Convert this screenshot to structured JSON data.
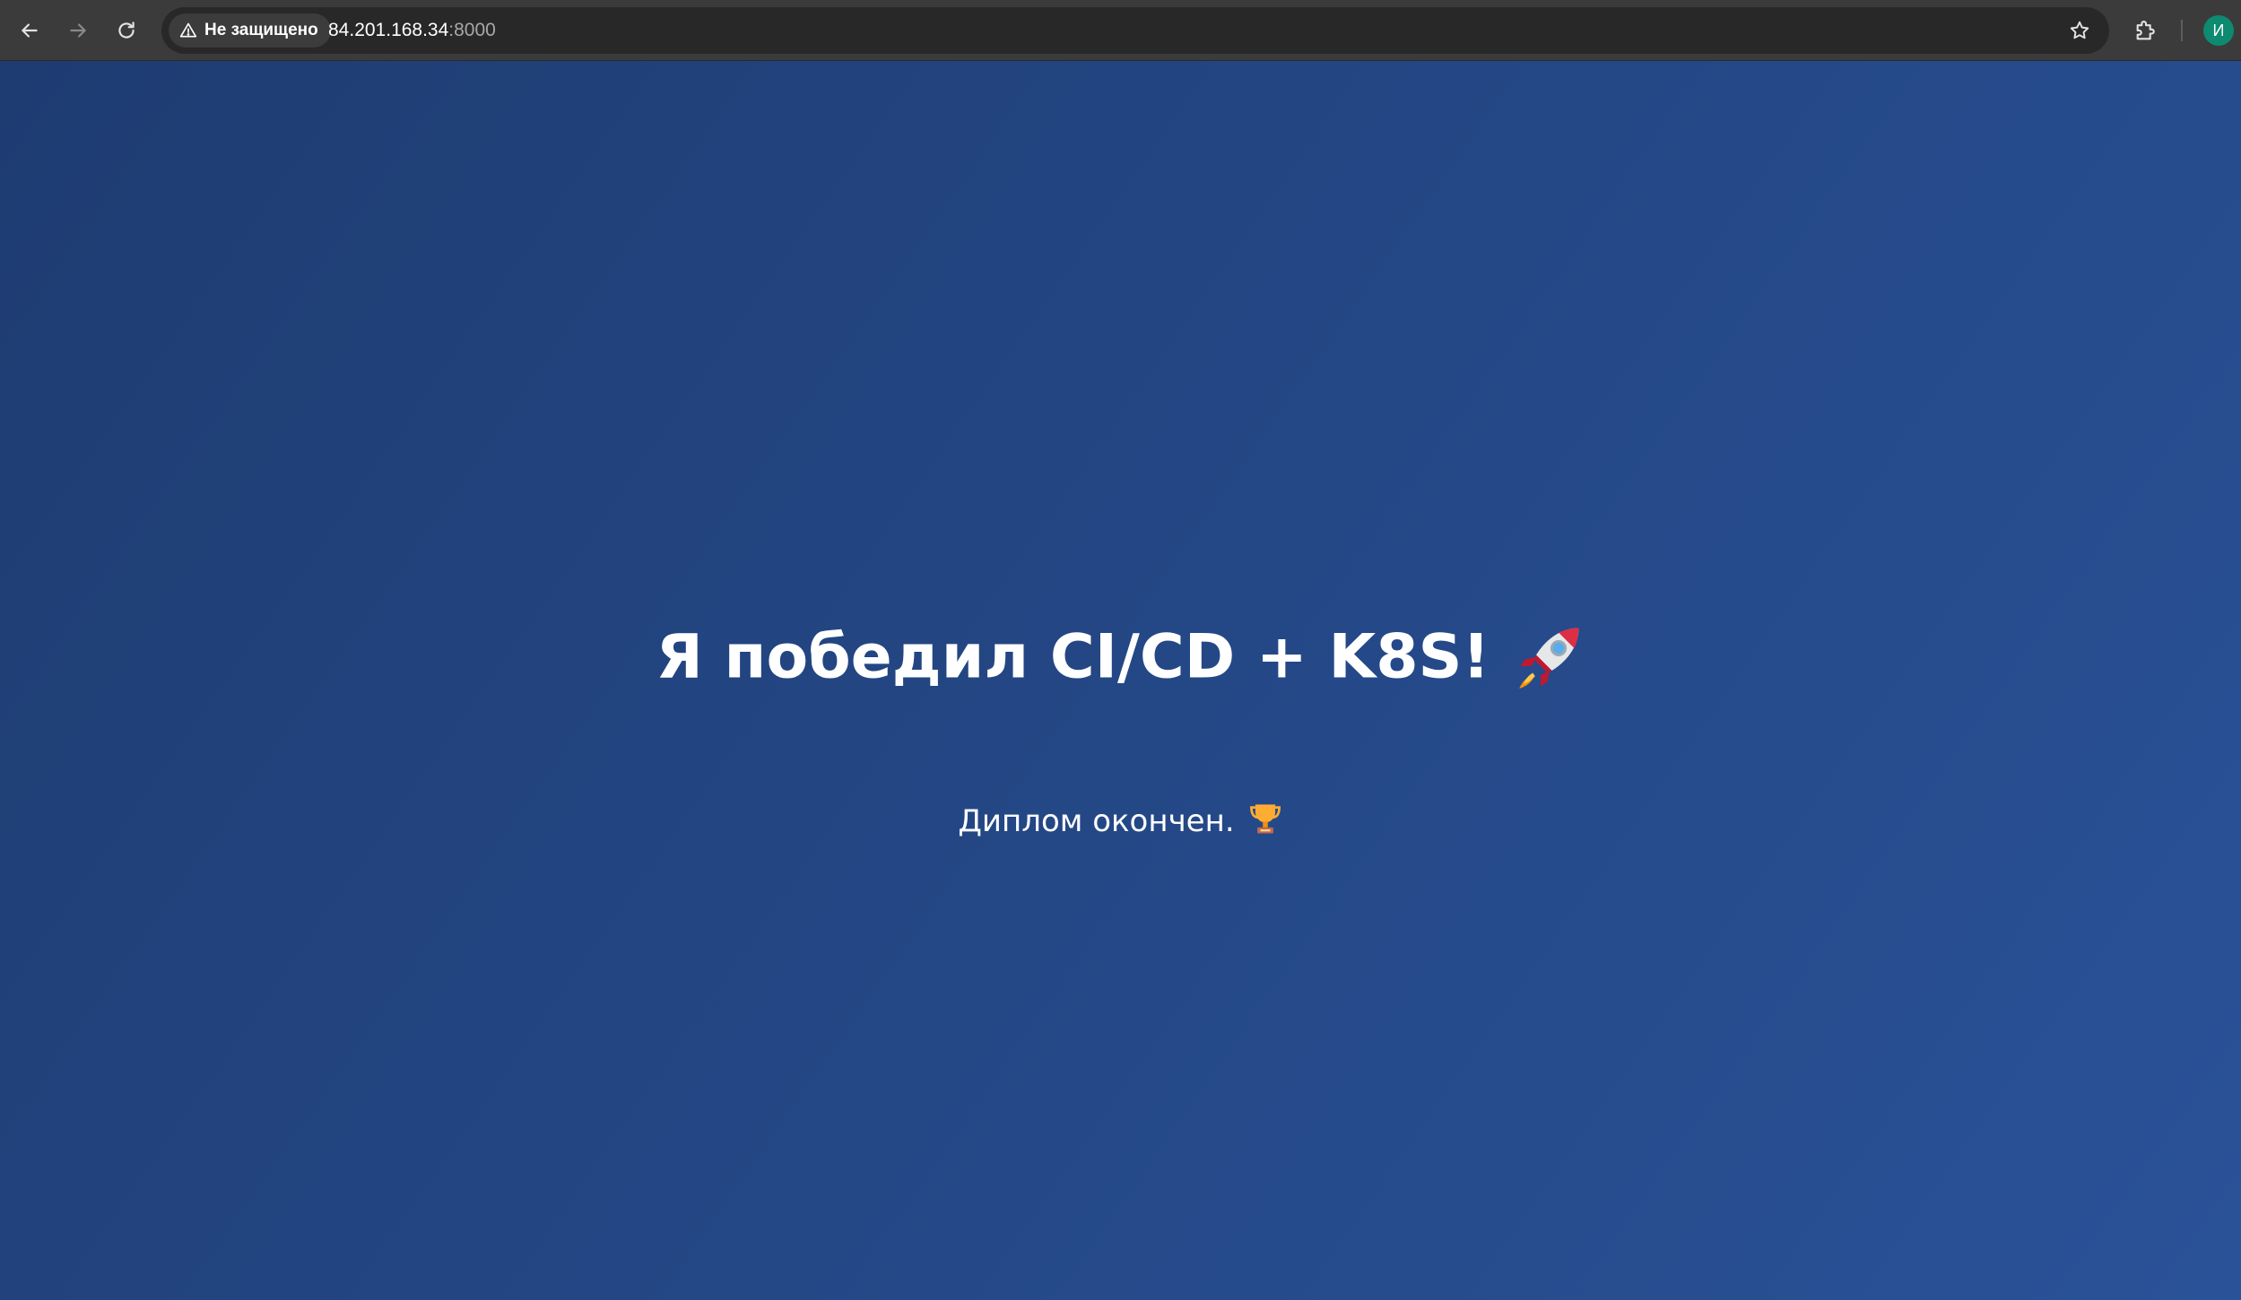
{
  "browser": {
    "security_label": "Не защищено",
    "url_host": "84.201.168.34",
    "url_port": ":8000",
    "profile_initial": "И",
    "icons": {
      "back": "arrow-left-icon",
      "forward": "arrow-right-icon",
      "reload": "reload-icon",
      "warning": "warning-triangle-icon",
      "bookmark": "star-icon",
      "extensions": "puzzle-icon"
    }
  },
  "page": {
    "title": "Я победил CI/CD + K8S!",
    "title_icon": "rocket-icon",
    "subtitle": "Диплом окончен.",
    "subtitle_icon": "trophy-icon",
    "background_colors": [
      "#1e3c72",
      "#2a5298"
    ]
  }
}
